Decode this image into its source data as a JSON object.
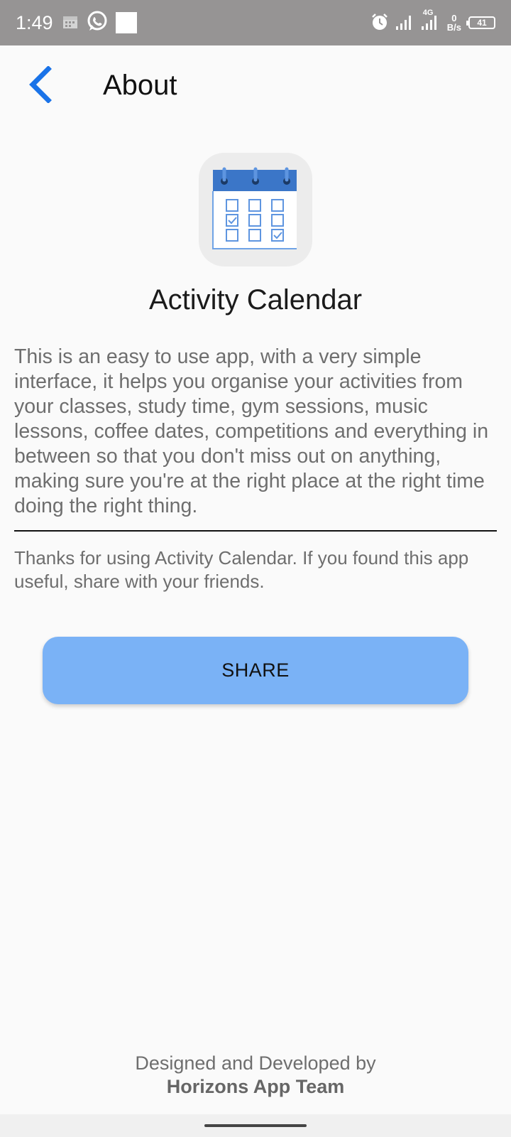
{
  "status_bar": {
    "time": "1:49",
    "network_speed_value": "0",
    "network_speed_unit": "B/s",
    "network_type": "4G",
    "battery": "41"
  },
  "header": {
    "title": "About"
  },
  "app": {
    "name": "Activity Calendar",
    "description": "This is an easy to use app, with a very simple interface, it helps you organise your activities from your classes, study time, gym sessions, music lessons, coffee dates, competitions and everything in between so that you don't miss out on anything, making sure you're at the right place at the right time doing the right thing.",
    "thanks": "Thanks for using Activity Calendar. If you found this app useful, share with your friends."
  },
  "actions": {
    "share_label": "SHARE"
  },
  "footer": {
    "line1": "Designed and Developed by",
    "line2": "Horizons App Team"
  },
  "colors": {
    "accent": "#1a73e8",
    "share_button": "#7ab2f6",
    "status_bar": "#969494"
  },
  "icons": [
    "back-icon",
    "calendar-app-icon",
    "alarm-icon",
    "whatsapp-icon",
    "signal-icon",
    "battery-icon"
  ]
}
